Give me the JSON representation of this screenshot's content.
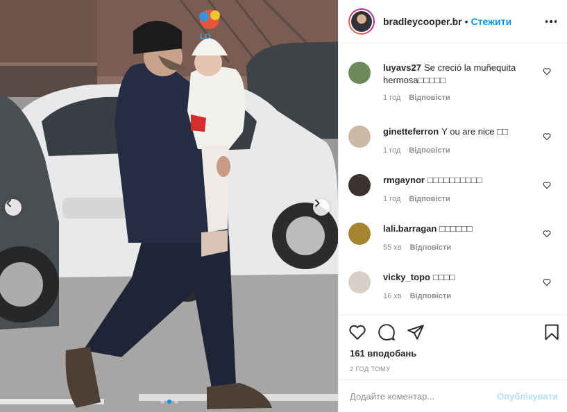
{
  "post": {
    "author": "bradleycooper.br",
    "follow_label": "Стежити",
    "header_separator": "•",
    "more_icon": "more-horizontal-icon",
    "likes": "161 вподобань",
    "time_ago": "2 ГОД ТОМУ",
    "carousel": {
      "total": 3,
      "active": 1
    }
  },
  "comments": [
    {
      "user": "luyavs27",
      "text": "Se creció la muñequita hermosa□□□□□",
      "time": "1 год",
      "reply_label": "Відповісти",
      "avatar_color": "#6f8a5a"
    },
    {
      "user": "ginetteferron",
      "text": "Y ou are nice □□",
      "time": "1 год",
      "reply_label": "Відповісти",
      "avatar_color": "#c9b9a6"
    },
    {
      "user": "rmgaynor",
      "text": "□□□□□□□□□□",
      "time": "1 год",
      "reply_label": "Відповісти",
      "avatar_color": "#3a3330"
    },
    {
      "user": "lali.barragan",
      "text": "□□□□□□",
      "time": "55 хв",
      "reply_label": "Відповісти",
      "avatar_color": "#a5852f"
    },
    {
      "user": "vicky_topo",
      "text": "□□□□",
      "time": "16 хв",
      "reply_label": "Відповісти",
      "avatar_color": "#d8d0c6"
    }
  ],
  "composer": {
    "placeholder": "Додайте коментар...",
    "post_label": "Опублікувати"
  },
  "colors": {
    "accent": "#0095f6",
    "post_disabled": "#b2dffc",
    "meta_text": "#8e8e8e"
  },
  "icons": [
    "heart-icon",
    "comment-icon",
    "share-icon",
    "bookmark-icon",
    "chevron-left-icon",
    "chevron-right-icon"
  ]
}
